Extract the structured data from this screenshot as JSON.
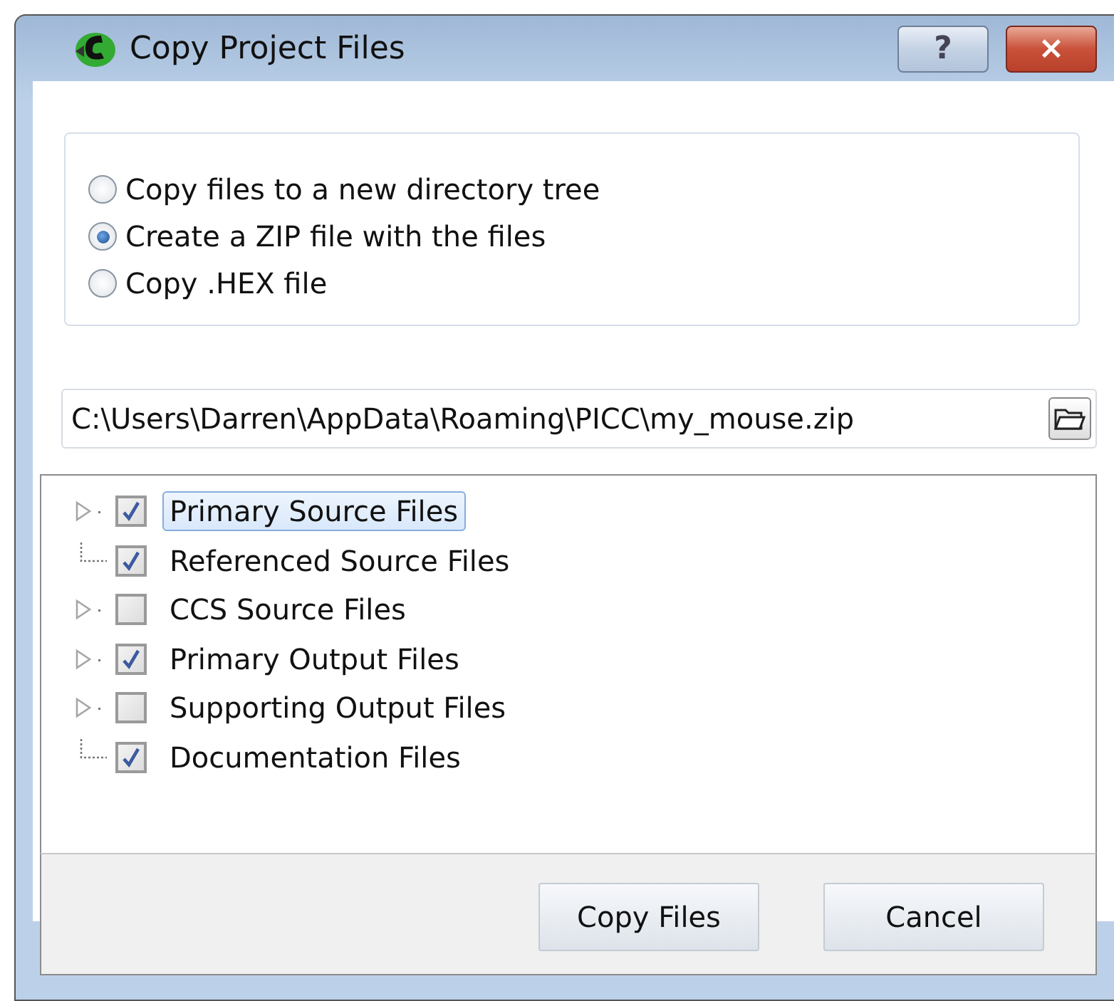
{
  "window": {
    "title": "Copy Project Files"
  },
  "title_buttons": [
    "?",
    "×"
  ],
  "options": [
    {
      "label": "Copy files to a new directory tree",
      "selected": false
    },
    {
      "label": "Create a ZIP file with the files",
      "selected": true
    },
    {
      "label": "Copy .HEX file",
      "selected": false
    }
  ],
  "path": {
    "value": "C:\\Users\\Darren\\AppData\\Roaming\\PICC\\my_mouse.zip"
  },
  "tree": [
    {
      "label": "Primary Source Files",
      "checked": true,
      "expandable": true,
      "selected": true
    },
    {
      "label": "Referenced Source Files",
      "checked": true,
      "expandable": false,
      "selected": false
    },
    {
      "label": "CCS Source Files",
      "checked": false,
      "expandable": true,
      "selected": false
    },
    {
      "label": "Primary Output Files",
      "checked": true,
      "expandable": true,
      "selected": false
    },
    {
      "label": "Supporting Output Files",
      "checked": false,
      "expandable": true,
      "selected": false
    },
    {
      "label": "Documentation Files",
      "checked": true,
      "expandable": false,
      "selected": false
    }
  ],
  "buttons": [
    "Copy Files",
    "Cancel"
  ]
}
